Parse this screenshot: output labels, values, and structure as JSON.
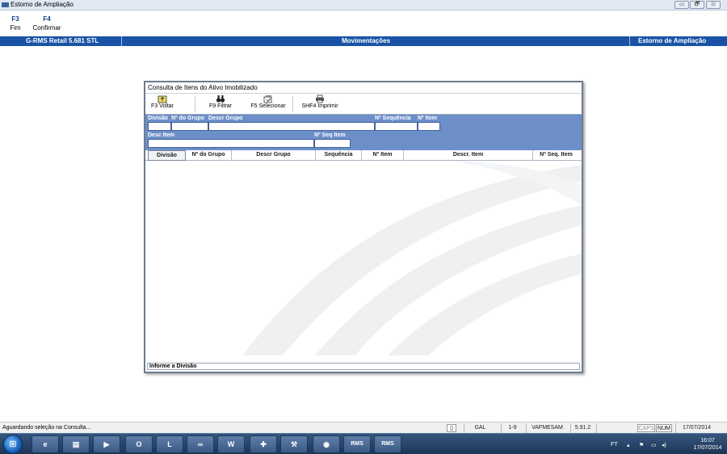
{
  "window": {
    "title": "Estorno de Ampliação",
    "controls": [
      "▭",
      "🗗",
      "⊠"
    ]
  },
  "fkeys": [
    {
      "key": "F3",
      "label": "Fim"
    },
    {
      "key": "F4",
      "label": "Confirmar"
    }
  ],
  "header": {
    "left": "G-RMS Retail 5.681 STL",
    "center": "Movimentações",
    "right": "Estorno de Ampliação"
  },
  "dialog": {
    "title": "Consulta de Itens do Ativo Imobilizado",
    "toolbar": [
      {
        "icon": "folder-up-icon",
        "label": "F3 Voltar"
      },
      {
        "icon": "binoculars-icon",
        "label": "F9 Filtrar"
      },
      {
        "icon": "select-icon",
        "label": "F5 Selecionar"
      },
      {
        "icon": "printer-icon",
        "label": "SHF4 Imprimir"
      }
    ],
    "filter": {
      "divisao": {
        "label": "Divisão",
        "value": ""
      },
      "nr_grupo": {
        "label": "Nº do Grupo",
        "value": ""
      },
      "descr_grupo": {
        "label": "Descr Grupo",
        "value": ""
      },
      "nr_sequencia": {
        "label": "Nº Sequência",
        "value": ""
      },
      "nr_item": {
        "label": "Nº Item",
        "value": ""
      },
      "desc_item": {
        "label": "Desc Item",
        "value": ""
      },
      "nr_seq_item": {
        "label": "Nº Seq Item",
        "value": ""
      }
    },
    "columns": [
      "Divisão",
      "Nº do Grupo",
      "Descr Grupo",
      "Sequência",
      "Nº Item",
      "Descr. Item",
      "Nº Seq. Item"
    ],
    "rows": [],
    "status": "Informe a Divisão"
  },
  "statusbar": {
    "message": "Aguardando seleção na Consulta...",
    "cells": [
      "GAL",
      "1-9",
      "VAFMESAM",
      "5.91.2",
      ""
    ],
    "caps": "CAPS",
    "num": "NUM",
    "date": "17/07/2014"
  },
  "taskbar": {
    "items": [
      "ie",
      "explorer",
      "media",
      "outlook",
      "lync",
      "infinity",
      "word",
      "app1",
      "app2",
      "app3",
      "RMS",
      "RMS"
    ],
    "tray_text": "FT",
    "time": "16:07",
    "date": "17/07/2014"
  }
}
